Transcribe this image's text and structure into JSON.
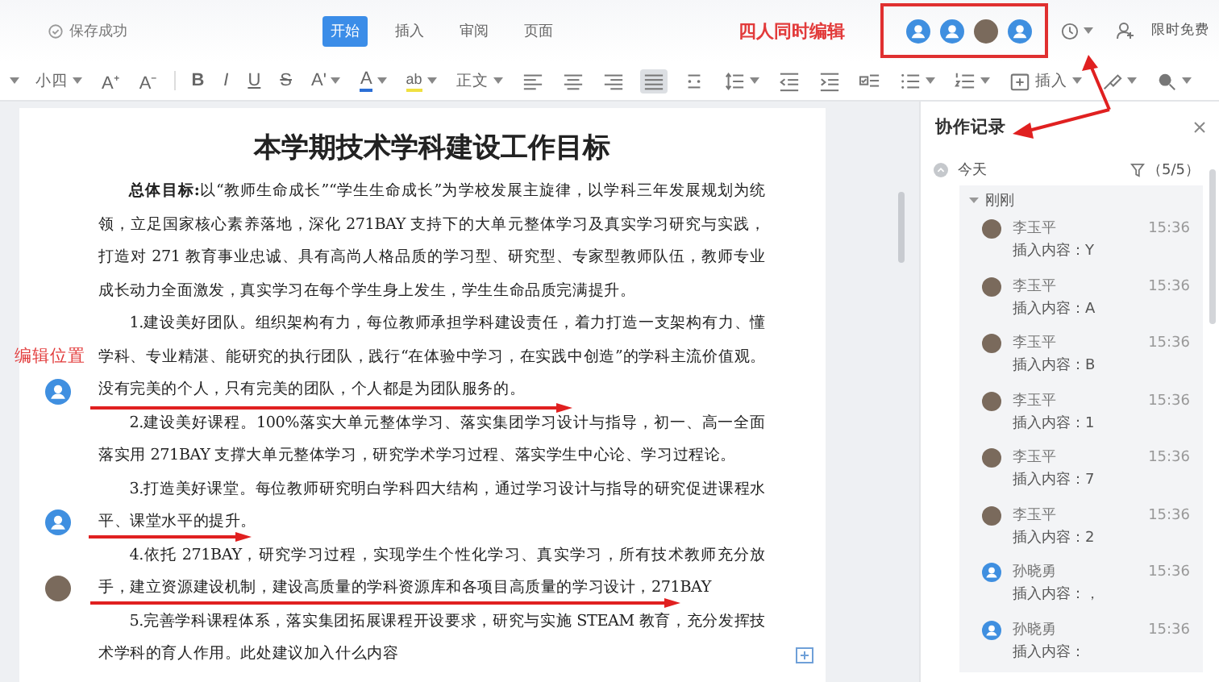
{
  "status": {
    "text": "保存成功"
  },
  "tabs": [
    {
      "label": "开始",
      "selected": true
    },
    {
      "label": "插入",
      "selected": false
    },
    {
      "label": "审阅",
      "selected": false
    },
    {
      "label": "页面",
      "selected": false
    }
  ],
  "editors_note": "四人同时编辑",
  "collaborators": [
    {
      "kind": "default"
    },
    {
      "kind": "default"
    },
    {
      "kind": "photo"
    },
    {
      "kind": "default"
    }
  ],
  "promo": "限时免费",
  "toolbar": [
    {
      "kind": "caret"
    },
    {
      "kind": "select",
      "label": "小四"
    },
    {
      "kind": "char",
      "label": "A⁺",
      "caret": false
    },
    {
      "kind": "char",
      "label": "A⁻",
      "caret": false
    },
    {
      "kind": "sep"
    },
    {
      "kind": "bold",
      "label": "B",
      "caret": false
    },
    {
      "kind": "italic",
      "label": "I",
      "caret": false
    },
    {
      "kind": "underline",
      "label": "U",
      "caret": false
    },
    {
      "kind": "strike",
      "label": "S",
      "caret": false
    },
    {
      "kind": "char",
      "label": "Aʹ",
      "caret": true
    },
    {
      "kind": "font-color",
      "label": "A",
      "caret": true
    },
    {
      "kind": "highlight",
      "label": "ab",
      "caret": true
    },
    {
      "kind": "select",
      "label": "正文"
    },
    {
      "kind": "icon",
      "caret": false,
      "selected": false
    },
    {
      "kind": "icon",
      "caret": false,
      "selected": false
    },
    {
      "kind": "icon",
      "caret": false,
      "selected": false
    },
    {
      "kind": "icon",
      "caret": false,
      "selected": true
    },
    {
      "kind": "icon",
      "caret": false,
      "selected": false
    },
    {
      "kind": "icon",
      "caret": true,
      "selected": false
    },
    {
      "kind": "icon",
      "caret": false,
      "selected": false
    },
    {
      "kind": "icon",
      "caret": false,
      "selected": false
    },
    {
      "kind": "icon",
      "caret": false,
      "selected": false
    },
    {
      "kind": "icon",
      "caret": true,
      "selected": false
    },
    {
      "kind": "icon",
      "caret": true,
      "selected": false
    },
    {
      "kind": "icon",
      "caret": true,
      "selected": false,
      "label": "插入"
    },
    {
      "kind": "icon",
      "caret": true,
      "selected": false
    },
    {
      "kind": "icon",
      "caret": true,
      "selected": false
    }
  ],
  "document": {
    "title": "本学期技术学科建设工作目标",
    "paragraphs": [
      "**总体目标:**以“教师生命成长”“学生生命成长”为学校发展主旋律，以学科三年发展规划为统领，立足国家核心素养落地，深化 271BAY 支持下的大单元整体学习及真实学习研究与实践，打造对 271 教育事业忠诚、具有高尚人格品质的学习型、研究型、专家型教师队伍，教师专业成长动力全面激发，真实学习在每个学生身上发生，学生生命品质完满提升。",
      "1.建设美好团队。组织架构有力，每位教师承担学科建设责任，着力打造一支架构有力、懂学科、专业精湛、能研究的执行团队，践行“在体验中学习，在实践中创造”的学科主流价值观。没有完美的个人，只有完美的团队，个人都是为团队服务的。",
      "2.建设美好课程。100%落实大单元整体学习、落实集团学习设计与指导，初一、高一全面落实用 271BAY 支撑大单元整体学习，研究学术学习过程、落实学生中心论、学习过程论。",
      "3.打造美好课堂。每位教师研究明白学科四大结构，通过学习设计与指导的研究促进课程水平、课堂水平的提升。",
      "4.依托 271BAY，研究学习过程，实现学生个性化学习、真实学习，所有技术教师充分放手，建立资源建设机制，建设高质量的学科资源库和各项目高质量的学习设计，271BAY",
      "5.完善学科课程体系，落实集团拓展课程开设要求，研究与实施 STEAM 教育，充分发挥技术学科的育人作用。此处建议加入什么内容"
    ]
  },
  "position_note": "编辑位置",
  "margin_editors": [
    {
      "kind": "default"
    },
    {
      "kind": "default"
    },
    {
      "kind": "photo"
    }
  ],
  "panel": {
    "title": "协作记录",
    "group": "今天",
    "filter": "（5/5）",
    "subgroup": {
      "label": "刚刚",
      "expanded": true
    },
    "records": [
      {
        "name": "李玉平",
        "avatar": {
          "kind": "photo"
        },
        "time": "15:36",
        "content": "插入内容：Y"
      },
      {
        "name": "李玉平",
        "avatar": {
          "kind": "photo"
        },
        "time": "15:36",
        "content": "插入内容：A"
      },
      {
        "name": "李玉平",
        "avatar": {
          "kind": "photo"
        },
        "time": "15:36",
        "content": "插入内容：B"
      },
      {
        "name": "李玉平",
        "avatar": {
          "kind": "photo"
        },
        "time": "15:36",
        "content": "插入内容：1"
      },
      {
        "name": "李玉平",
        "avatar": {
          "kind": "photo"
        },
        "time": "15:36",
        "content": "插入内容：7"
      },
      {
        "name": "李玉平",
        "avatar": {
          "kind": "photo"
        },
        "time": "15:36",
        "content": "插入内容：2"
      },
      {
        "name": "孙晓勇",
        "avatar": {
          "kind": "default"
        },
        "time": "15:36",
        "content": "插入内容：，"
      },
      {
        "name": "孙晓勇",
        "avatar": {
          "kind": "default"
        },
        "time": "15:36",
        "content": "插入内容："
      }
    ]
  }
}
